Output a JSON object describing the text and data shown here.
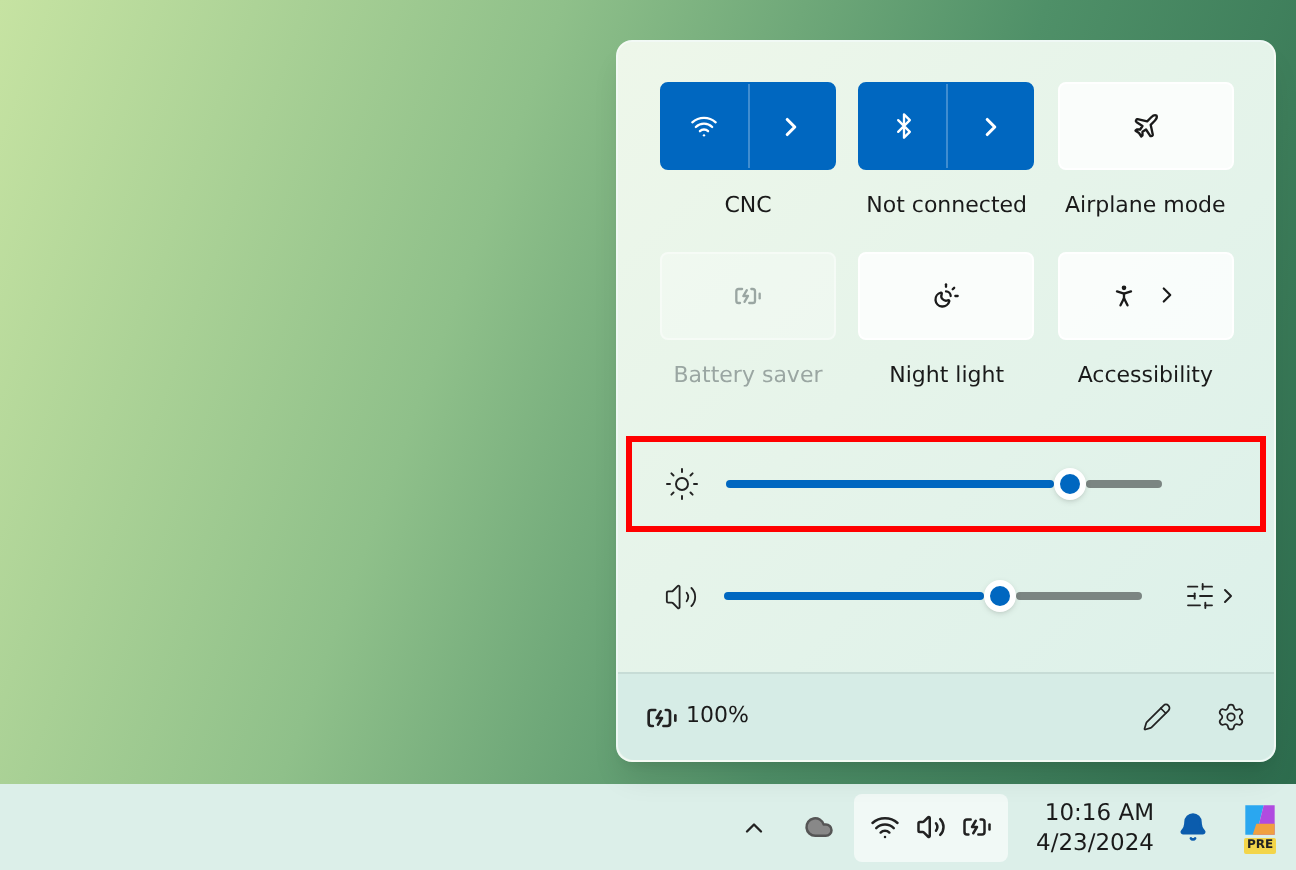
{
  "quick_settings": {
    "tiles": [
      {
        "kind": "split",
        "label": "CNC",
        "on": true,
        "disabled": false
      },
      {
        "kind": "split",
        "label": "Not connected",
        "on": true,
        "disabled": false
      },
      {
        "kind": "simple",
        "label": "Airplane mode",
        "on": false,
        "disabled": false
      },
      {
        "kind": "simple",
        "label": "Battery saver",
        "on": false,
        "disabled": true
      },
      {
        "kind": "simple",
        "label": "Night light",
        "on": false,
        "disabled": false
      },
      {
        "kind": "expand",
        "label": "Accessibility",
        "on": false,
        "disabled": false
      }
    ],
    "brightness": {
      "level": 0.79,
      "highlighted": true
    },
    "volume": {
      "level": 0.66
    },
    "battery": "100%"
  },
  "taskbar": {
    "time": "10:16 AM",
    "date": "4/23/2024",
    "copilot_badge": "PRE"
  }
}
